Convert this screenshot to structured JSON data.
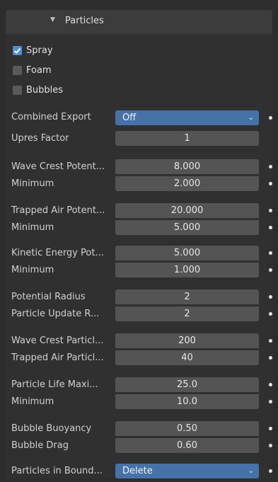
{
  "panel": {
    "title": "Particles",
    "collapse_arrow": "▼"
  },
  "checkboxes": [
    {
      "label": "Spray",
      "checked": true
    },
    {
      "label": "Foam",
      "checked": false
    },
    {
      "label": "Bubbles",
      "checked": false
    }
  ],
  "combined_export": {
    "label": "Combined Export",
    "value": "Off",
    "chevron": "⌄"
  },
  "upres": {
    "label": "Upres Factor",
    "value": "1"
  },
  "wave_crest": {
    "label": "Wave Crest Potent...",
    "value": "8.000",
    "min_label": "Minimum",
    "min_value": "2.000"
  },
  "trapped_air": {
    "label": "Trapped Air Potent...",
    "value": "20.000",
    "min_label": "Minimum",
    "min_value": "5.000"
  },
  "kinetic": {
    "label": "Kinetic Energy Pot...",
    "value": "5.000",
    "min_label": "Minimum",
    "min_value": "1.000"
  },
  "potential_radius": {
    "label": "Potential Radius",
    "value": "2"
  },
  "particle_update": {
    "label": "Particle Update R...",
    "value": "2"
  },
  "wave_crest_particles": {
    "label": "Wave Crest Particl...",
    "value": "200"
  },
  "trapped_air_particles": {
    "label": "Trapped Air Particl...",
    "value": "40"
  },
  "life_max": {
    "label": "Particle Life Maxi...",
    "value": "25.0",
    "min_label": "Minimum",
    "min_value": "10.0"
  },
  "bubble_buoyancy": {
    "label": "Bubble Buoyancy",
    "value": "0.50"
  },
  "bubble_drag": {
    "label": "Bubble Drag",
    "value": "0.60"
  },
  "particles_boundary": {
    "label": "Particles in Bound...",
    "value": "Delete",
    "chevron": "⌄"
  },
  "colors": {
    "accent": "#4672a8",
    "checkbox_on": "#4f8ed0",
    "field": "#545454"
  }
}
